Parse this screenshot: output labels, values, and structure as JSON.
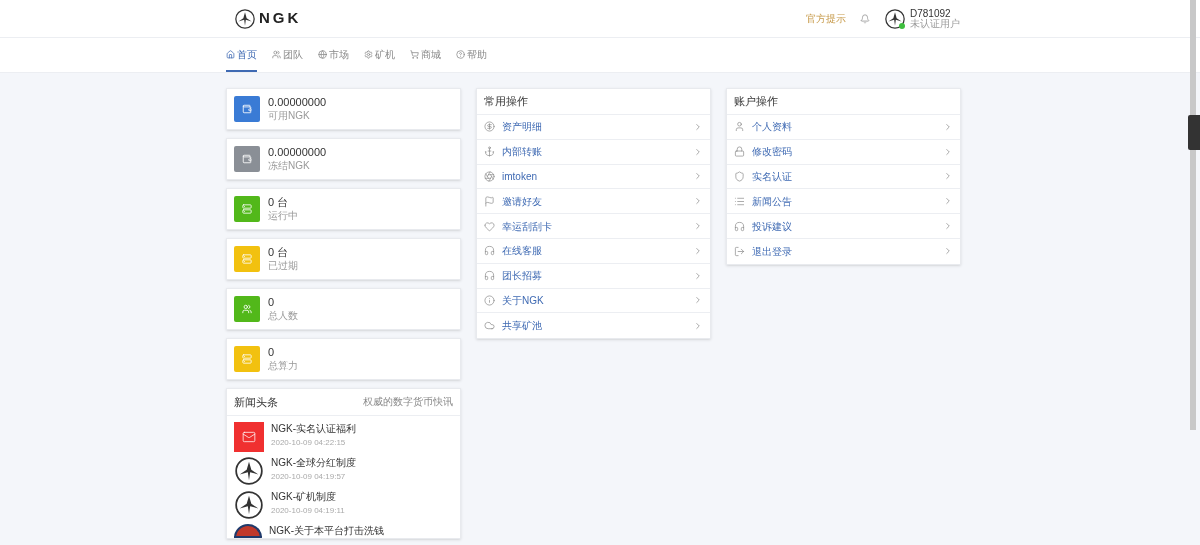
{
  "header": {
    "logo_text": "NGK",
    "notice_link": "官方提示",
    "user": {
      "id": "D781092",
      "status": "未认证用户",
      "online": true
    }
  },
  "nav": [
    {
      "label": "首页",
      "kind": "home",
      "selected": true
    },
    {
      "label": "团队",
      "kind": "users",
      "selected": false
    },
    {
      "label": "市场",
      "kind": "globe",
      "selected": false
    },
    {
      "label": "矿机",
      "kind": "cog",
      "selected": false
    },
    {
      "label": "商城",
      "kind": "cart",
      "selected": false
    },
    {
      "label": "帮助",
      "kind": "help",
      "selected": false
    }
  ],
  "stats": [
    {
      "value": "0.00000000",
      "label": "可用NGK",
      "color": "#3a7bd5"
    },
    {
      "value": "0.00000000",
      "label": "冻结NGK",
      "color": "#8a8f96"
    },
    {
      "value": "0 台",
      "label": "运行中",
      "color": "#52b81a"
    },
    {
      "value": "0 台",
      "label": "已过期",
      "color": "#f2c10f"
    },
    {
      "value": "0",
      "label": "总人数",
      "color": "#52b81a"
    },
    {
      "value": "0",
      "label": "总算力",
      "color": "#f2c10f"
    }
  ],
  "news": {
    "title": "新闻头条",
    "subtitle": "权威的数字货币快讯",
    "items": [
      {
        "title": "NGK-实名认证福利",
        "date": "2020-10-09 04:22:15",
        "kind": "envelope"
      },
      {
        "title": "NGK-全球分红制度",
        "date": "2020-10-09 04:19:57",
        "kind": "logo"
      },
      {
        "title": "NGK-矿机制度",
        "date": "2020-10-09 04:19:11",
        "kind": "logo"
      },
      {
        "title": "NGK-关于本平台打击洗钱",
        "kind": "badge"
      }
    ]
  },
  "common_actions": {
    "title": "常用操作",
    "items": [
      {
        "label": "资产明细",
        "kind": "coin"
      },
      {
        "label": "内部转账",
        "kind": "anchor"
      },
      {
        "label": "imtoken",
        "kind": "aperture"
      },
      {
        "label": "邀请好友",
        "kind": "flag"
      },
      {
        "label": "幸运刮刮卡",
        "kind": "heart"
      },
      {
        "label": "在线客服",
        "kind": "headphones"
      },
      {
        "label": "团长招募",
        "kind": "headphones"
      },
      {
        "label": "关于NGK",
        "kind": "info"
      },
      {
        "label": "共享矿池",
        "kind": "cloud"
      }
    ]
  },
  "account_actions": {
    "title": "账户操作",
    "items": [
      {
        "label": "个人资料",
        "kind": "user"
      },
      {
        "label": "修改密码",
        "kind": "lock"
      },
      {
        "label": "实名认证",
        "kind": "shield"
      },
      {
        "label": "新闻公告",
        "kind": "list"
      },
      {
        "label": "投诉建议",
        "kind": "headphones"
      },
      {
        "label": "退出登录",
        "kind": "logout"
      }
    ]
  }
}
